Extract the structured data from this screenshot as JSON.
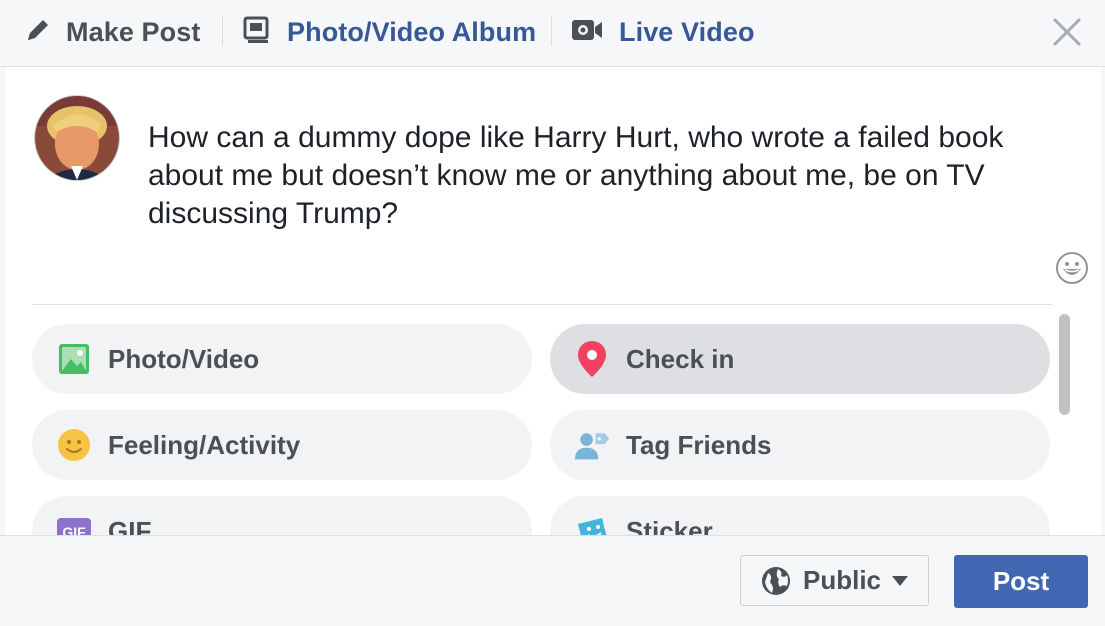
{
  "tabs": {
    "make_post": "Make Post",
    "album": "Photo/Video Album",
    "live": "Live Video"
  },
  "post": {
    "text": "How can a dummy dope like Harry Hurt, who wrote a failed book about me but doesn’t know me or anything about me, be on TV discussing Trump?"
  },
  "actions": {
    "photo_video": "Photo/Video",
    "check_in": "Check in",
    "feeling": "Feeling/Activity",
    "tag_friends": "Tag Friends",
    "gif": "GIF",
    "sticker": "Sticker",
    "gif_badge": "GIF"
  },
  "footer": {
    "privacy": "Public",
    "post_button": "Post"
  },
  "colors": {
    "link_blue": "#365899",
    "post_button_blue": "#4267b2",
    "checkin_pin": "#f3425f",
    "photo_green": "#45bd62",
    "feeling_yellow": "#f7b928"
  },
  "icons": [
    "pencil-icon",
    "photo-album-icon",
    "video-camera-icon",
    "close-icon",
    "emoji-icon",
    "photo-icon",
    "location-pin-icon",
    "smiley-icon",
    "tag-friends-icon",
    "gif-icon",
    "sticker-icon",
    "globe-icon",
    "caret-down-icon"
  ]
}
